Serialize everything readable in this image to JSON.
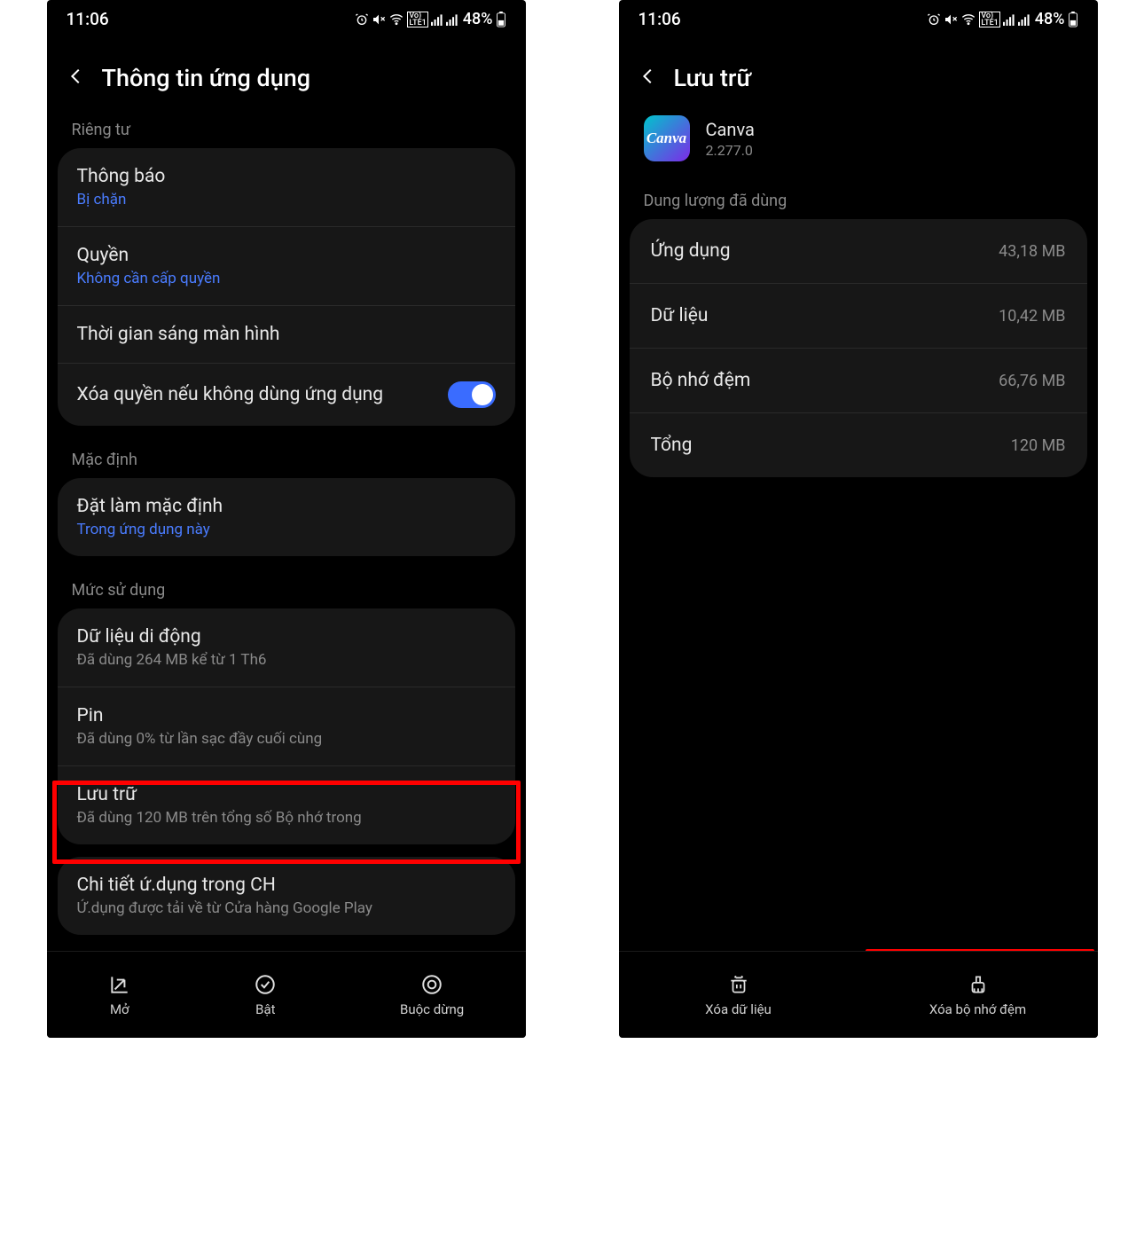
{
  "status": {
    "time": "11:06",
    "volte": "LTE1",
    "battery_pct": "48%"
  },
  "left": {
    "title": "Thông tin ứng dụng",
    "sections": {
      "privacy_label": "Riêng tư",
      "notifications": {
        "title": "Thông báo",
        "sub": "Bị chặn"
      },
      "permissions": {
        "title": "Quyền",
        "sub": "Không cần cấp quyền"
      },
      "screen_time": {
        "title": "Thời gian sáng màn hình"
      },
      "remove_perm": {
        "title": "Xóa quyền nếu không dùng ứng dụng"
      },
      "default_label": "Mặc định",
      "set_default": {
        "title": "Đặt làm mặc định",
        "sub": "Trong ứng dụng này"
      },
      "usage_label": "Mức sử dụng",
      "mobile_data": {
        "title": "Dữ liệu di động",
        "sub": "Đã dùng 264 MB kể từ 1 Th6"
      },
      "battery": {
        "title": "Pin",
        "sub": "Đã dùng 0% từ lần sạc đầy cuối cùng"
      },
      "storage": {
        "title": "Lưu trữ",
        "sub": "Đã dùng 120 MB trên tổng số Bộ nhớ trong"
      },
      "store_label": {
        "title": "Chi tiết ứ.dụng trong CH",
        "sub": "Ứ.dụng được tải về từ Cửa hàng Google Play"
      }
    },
    "bottom": {
      "open": "Mở",
      "enable": "Bật",
      "force_stop": "Buộc dừng"
    }
  },
  "right": {
    "title": "Lưu trữ",
    "app": {
      "name": "Canva",
      "version": "2.277.0",
      "icon_text": "Canva"
    },
    "usage_label": "Dung lượng đã dùng",
    "rows": {
      "app": {
        "k": "Ứng dụng",
        "v": "43,18 MB"
      },
      "data": {
        "k": "Dữ liệu",
        "v": "10,42 MB"
      },
      "cache": {
        "k": "Bộ nhớ đệm",
        "v": "66,76 MB"
      },
      "total": {
        "k": "Tổng",
        "v": "120 MB"
      }
    },
    "bottom": {
      "clear_data": "Xóa dữ liệu",
      "clear_cache": "Xóa bộ nhớ đệm"
    }
  }
}
